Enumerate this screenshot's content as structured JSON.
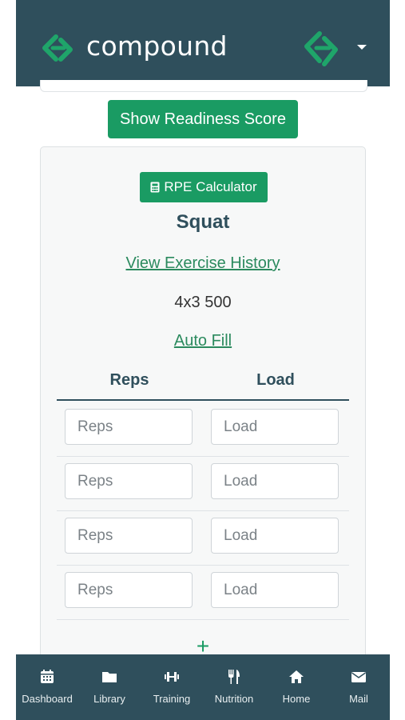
{
  "app": {
    "name": "compound"
  },
  "header": {
    "brand": "compound"
  },
  "readiness_button": "Show Readiness Score",
  "exercise": {
    "rpe_button": "RPE Calculator",
    "name": "Squat",
    "history_link": "View Exercise History",
    "prescription": "4x3 500",
    "autofill_link": "Auto Fill",
    "columns": [
      "Reps",
      "Load"
    ],
    "sets": [
      {
        "reps_placeholder": "Reps",
        "load_placeholder": "Load"
      },
      {
        "reps_placeholder": "Reps",
        "load_placeholder": "Load"
      },
      {
        "reps_placeholder": "Reps",
        "load_placeholder": "Load"
      },
      {
        "reps_placeholder": "Reps",
        "load_placeholder": "Load"
      }
    ],
    "add_set_symbol": "+"
  },
  "nav": [
    {
      "label": "Dashboard",
      "icon": "calendar-icon"
    },
    {
      "label": "Library",
      "icon": "folder-icon"
    },
    {
      "label": "Training",
      "icon": "dumbbell-icon"
    },
    {
      "label": "Nutrition",
      "icon": "utensils-icon"
    },
    {
      "label": "Home",
      "icon": "home-icon"
    },
    {
      "label": "Mail",
      "icon": "mail-icon"
    }
  ],
  "colors": {
    "header_bg": "#2f4f5c",
    "accent_green": "#1a9b63",
    "link_green": "#2b8a5e",
    "logo_green": "#1fa56a"
  }
}
